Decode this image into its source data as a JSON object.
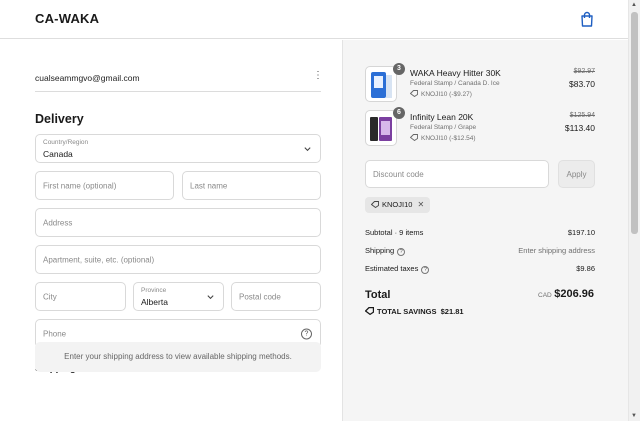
{
  "header": {
    "brand": "CA-WAKA",
    "cart_icon": "shopping-bag-icon"
  },
  "contact": {
    "email": "cualseammgvo@gmail.com"
  },
  "delivery": {
    "title": "Delivery",
    "country": {
      "label": "Country/Region",
      "value": "Canada"
    },
    "first_name": {
      "placeholder": "First name (optional)"
    },
    "last_name": {
      "placeholder": "Last name"
    },
    "address": {
      "placeholder": "Address"
    },
    "apartment": {
      "placeholder": "Apartment, suite, etc. (optional)"
    },
    "city": {
      "placeholder": "City"
    },
    "province": {
      "label": "Province",
      "value": "Alberta"
    },
    "postal": {
      "placeholder": "Postal code"
    },
    "phone": {
      "placeholder": "Phone"
    }
  },
  "shipping_method": {
    "title": "Shipping method",
    "message": "Enter your shipping address to view available shipping methods."
  },
  "order": {
    "items": [
      {
        "quantity": "3",
        "name": "WAKA Heavy Hitter 30K",
        "variant": "Federal Stamp / Canada D. Ice",
        "discount": "KNOJI10 (-$9.27)",
        "original_price": "$92.97",
        "price": "$83.70",
        "thumb_color": "#2b6fd6"
      },
      {
        "quantity": "6",
        "name": "Infinity Lean 20K",
        "variant": "Federal Stamp / Grape",
        "discount": "KNOJI10 (-$12.54)",
        "original_price": "$125.94",
        "price": "$113.40",
        "thumb_color": "#7b3fa0"
      }
    ],
    "discount_code": {
      "placeholder": "Discount code",
      "apply_label": "Apply"
    },
    "applied_code": "KNOJI10",
    "summary": {
      "subtotal_label": "Subtotal · 9 items",
      "subtotal_value": "$197.10",
      "shipping_label": "Shipping",
      "shipping_value": "Enter shipping address",
      "taxes_label": "Estimated taxes",
      "taxes_value": "$9.86",
      "total_label": "Total",
      "currency": "CAD",
      "total_value": "$206.96",
      "savings_label": "TOTAL SAVINGS",
      "savings_value": "$21.81"
    }
  }
}
